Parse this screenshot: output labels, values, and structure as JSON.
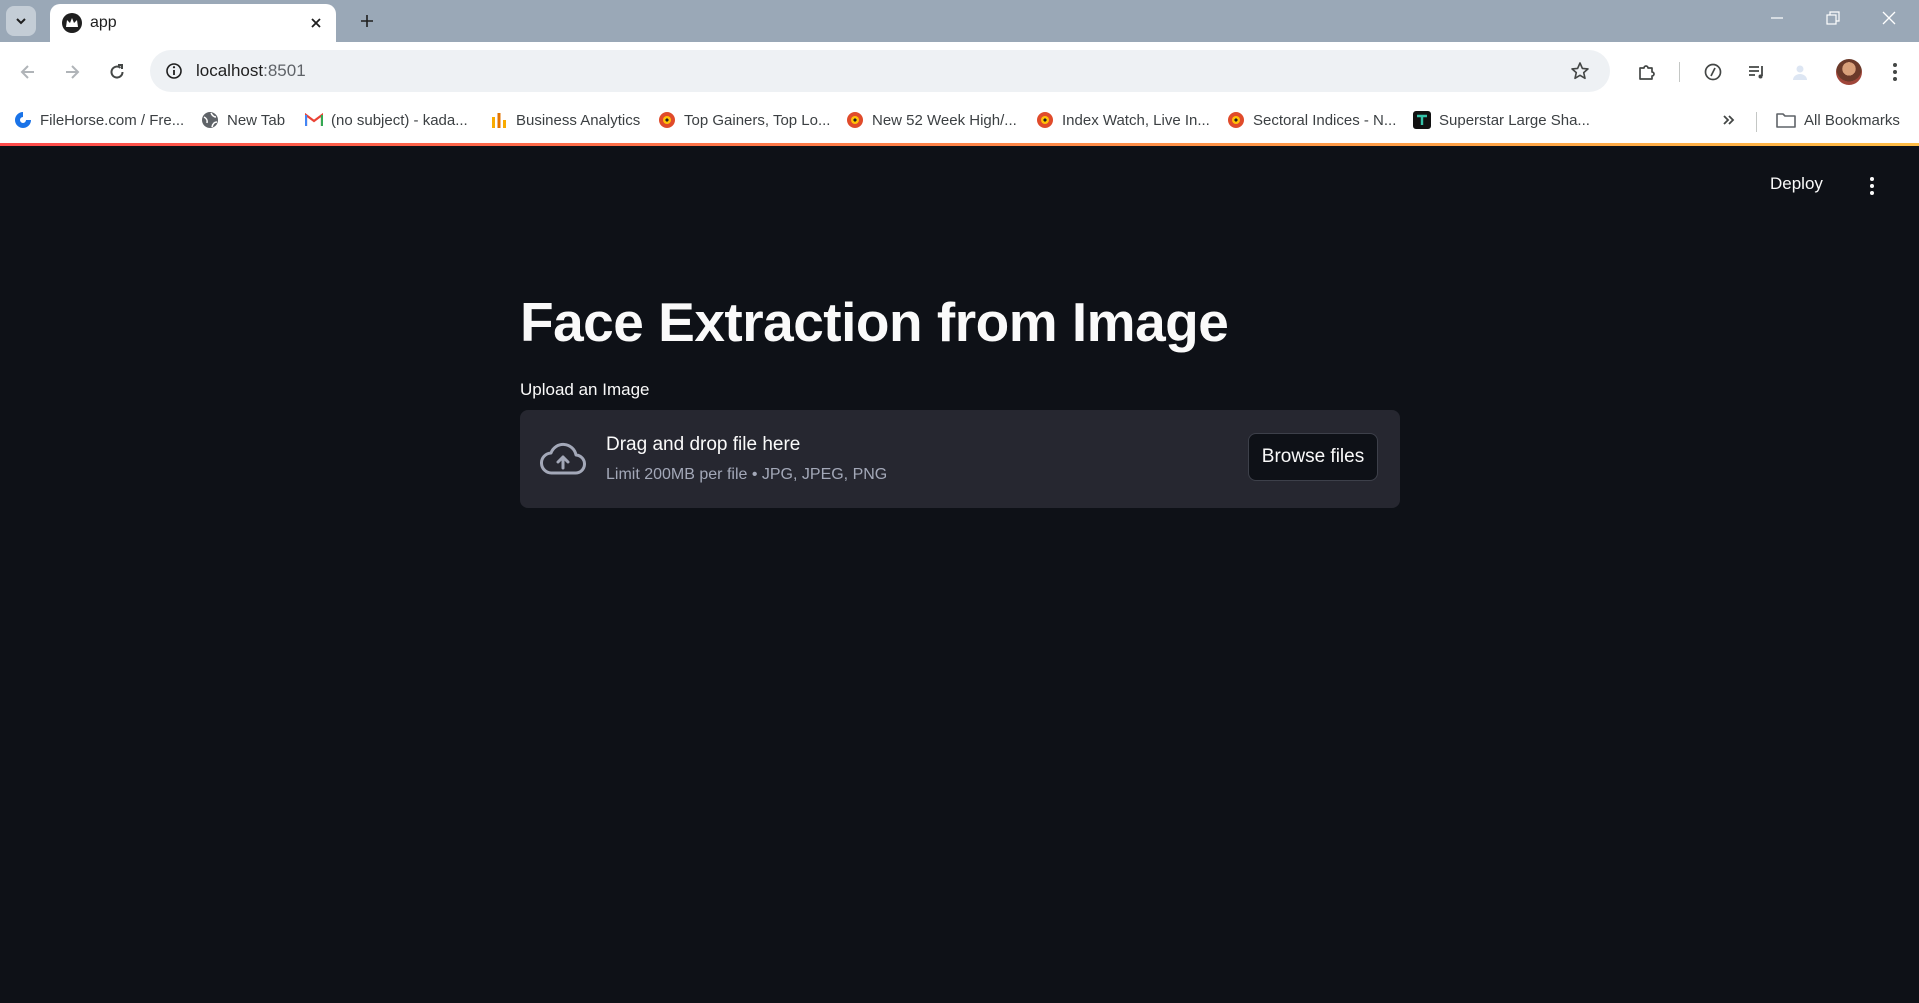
{
  "browser": {
    "tab_title": "app",
    "url_host": "localhost",
    "url_port": ":8501",
    "bookmarks": [
      {
        "label": "FileHorse.com / Fre...",
        "icon": "filehorse-icon"
      },
      {
        "label": "New Tab",
        "icon": "globe-icon"
      },
      {
        "label": "(no subject) - kada...",
        "icon": "gmail-icon"
      },
      {
        "label": "Business Analytics",
        "icon": "analytics-icon"
      },
      {
        "label": "Top Gainers, Top Lo...",
        "icon": "moneycontrol-icon"
      },
      {
        "label": "New 52 Week High/...",
        "icon": "moneycontrol-icon"
      },
      {
        "label": "Index Watch, Live In...",
        "icon": "moneycontrol-icon"
      },
      {
        "label": "Sectoral Indices - N...",
        "icon": "moneycontrol-icon"
      },
      {
        "label": "Superstar Large Sha...",
        "icon": "trendlyne-icon"
      }
    ],
    "all_bookmarks_label": "All Bookmarks"
  },
  "app": {
    "deploy_label": "Deploy",
    "title": "Face Extraction from Image",
    "uploader": {
      "label": "Upload an Image",
      "instruction": "Drag and drop file here",
      "limits": "Limit 200MB per file • JPG, JPEG, PNG",
      "button_label": "Browse files"
    }
  },
  "colors": {
    "app_background": "#0e1117",
    "dropzone_background": "#262730",
    "text_primary": "#fafafa",
    "text_secondary": "#a3a8b8",
    "header_decoration_start": "#ff4b4b",
    "header_decoration_end": "#ffbd45"
  }
}
